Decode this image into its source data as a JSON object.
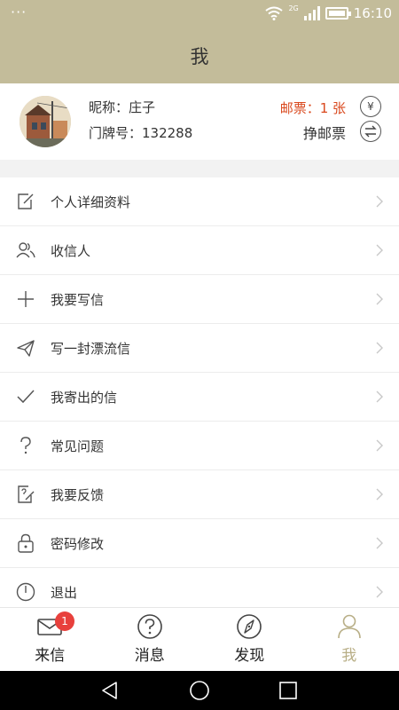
{
  "status_bar": {
    "time": "16:10",
    "network": "2G",
    "dots": "···"
  },
  "header": {
    "title": "我"
  },
  "profile": {
    "nickname_label": "昵称：庄子",
    "door_number_label": "门牌号：132288",
    "stamp_count": "邮票：1 张",
    "earn_stamps": "挣邮票",
    "yen_icon_glyph": "¥"
  },
  "menu": {
    "items": [
      {
        "label": "个人详细资料",
        "icon": "edit-icon"
      },
      {
        "label": "收信人",
        "icon": "contacts-icon"
      },
      {
        "label": "我要写信",
        "icon": "plus-icon"
      },
      {
        "label": "写一封漂流信",
        "icon": "paper-plane-icon"
      },
      {
        "label": "我寄出的信",
        "icon": "check-icon"
      },
      {
        "label": "常见问题",
        "icon": "question-icon"
      },
      {
        "label": "我要反馈",
        "icon": "feedback-icon"
      },
      {
        "label": "密码修改",
        "icon": "lock-icon"
      },
      {
        "label": "退出",
        "icon": "power-icon"
      }
    ]
  },
  "tabbar": {
    "tabs": [
      {
        "label": "来信",
        "icon": "mail-icon",
        "badge": "1"
      },
      {
        "label": "消息",
        "icon": "question-circle-icon"
      },
      {
        "label": "发现",
        "icon": "compass-icon"
      },
      {
        "label": "我",
        "icon": "user-icon",
        "active": true
      }
    ]
  },
  "colors": {
    "header_bg": "#c3bc9a",
    "stamp_red": "#d9481d",
    "badge_red": "#e8403c",
    "active_tab": "#b8ae86"
  }
}
